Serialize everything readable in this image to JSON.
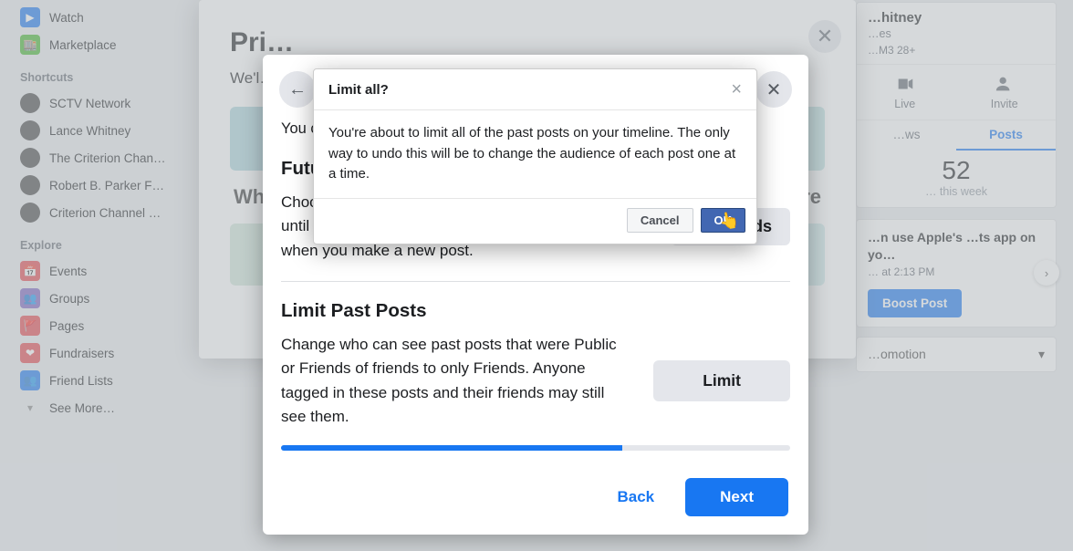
{
  "sidebar": {
    "items_top": [
      {
        "icon": "watch",
        "label": "Watch"
      },
      {
        "icon": "marketplace",
        "label": "Marketplace"
      }
    ],
    "shortcuts_heading": "Shortcuts",
    "shortcuts": [
      {
        "label": "SCTV Network"
      },
      {
        "label": "Lance Whitney"
      },
      {
        "label": "The Criterion Chan…"
      },
      {
        "label": "Robert B. Parker F…"
      },
      {
        "label": "Criterion Channel …"
      }
    ],
    "explore_heading": "Explore",
    "explore": [
      {
        "icon": "red",
        "label": "Events"
      },
      {
        "icon": "bluepeople",
        "label": "Groups"
      },
      {
        "icon": "red",
        "label": "Pages"
      },
      {
        "icon": "red",
        "label": "Fundraisers"
      },
      {
        "icon": "bluepeople",
        "label": "Friend Lists"
      }
    ],
    "see_more": "See More…"
  },
  "right": {
    "profile_name": "…hitney",
    "profile_sub": "…es",
    "profile_stats": "…M3   28+",
    "action_live": "Live",
    "action_invite": "Invite",
    "tab_views": "…ws",
    "tab_posts": "Posts",
    "big_stat": "52",
    "stat_sub": "… this week",
    "boost_title": "…n use Apple's …ts app on yo…",
    "boost_time": "… at 2:13 PM",
    "boost_btn": "Boost Post",
    "promotion_row": "…omotion"
  },
  "privModal": {
    "title": "Pri…",
    "sub": "We'l… your acco…",
    "row_left": "Wh…",
    "row_right": "…re"
  },
  "inner": {
    "lead": "You c…",
    "future_h": "Futu…",
    "future_txt": "Choo… audience will be who can see your posts until you change it. You can always change it when you make a new post.",
    "friends_btn": "Friends",
    "limit_h": "Limit Past Posts",
    "limit_txt": "Change who can see past posts that were Public or Friends of friends to only Friends. Anyone tagged in these posts and their friends may still see them.",
    "limit_btn": "Limit",
    "back_btn": "Back",
    "next_btn": "Next"
  },
  "confirm": {
    "title": "Limit all?",
    "body": "You're about to limit all of the past posts on your timeline. The only way to undo this will be to change the audience of each post one at a time.",
    "cancel": "Cancel",
    "ok": "OK"
  }
}
